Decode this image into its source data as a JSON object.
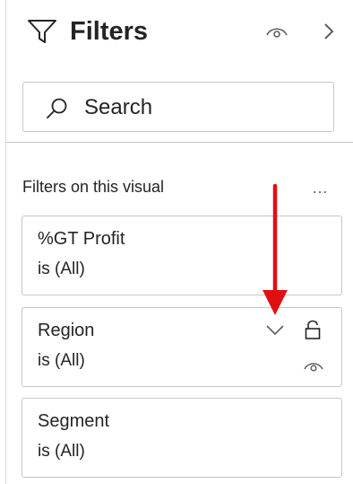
{
  "pane": {
    "title": "Filters",
    "icons": {
      "funnel": "filter-icon",
      "visibility": "eye-icon",
      "collapse": "chevron-right-icon"
    }
  },
  "search": {
    "label": "Search",
    "icon": "search-icon"
  },
  "section": {
    "title": "Filters on this visual",
    "more": "…"
  },
  "filters": [
    {
      "name": "%GT Profit",
      "value": "is (All)"
    },
    {
      "name": "Region",
      "value": "is (All)",
      "icons": [
        "chevron-down-icon",
        "lock-icon",
        "eye-icon"
      ]
    },
    {
      "name": "Segment",
      "value": "is (All)"
    }
  ],
  "annotation": {
    "color": "#e01010"
  }
}
